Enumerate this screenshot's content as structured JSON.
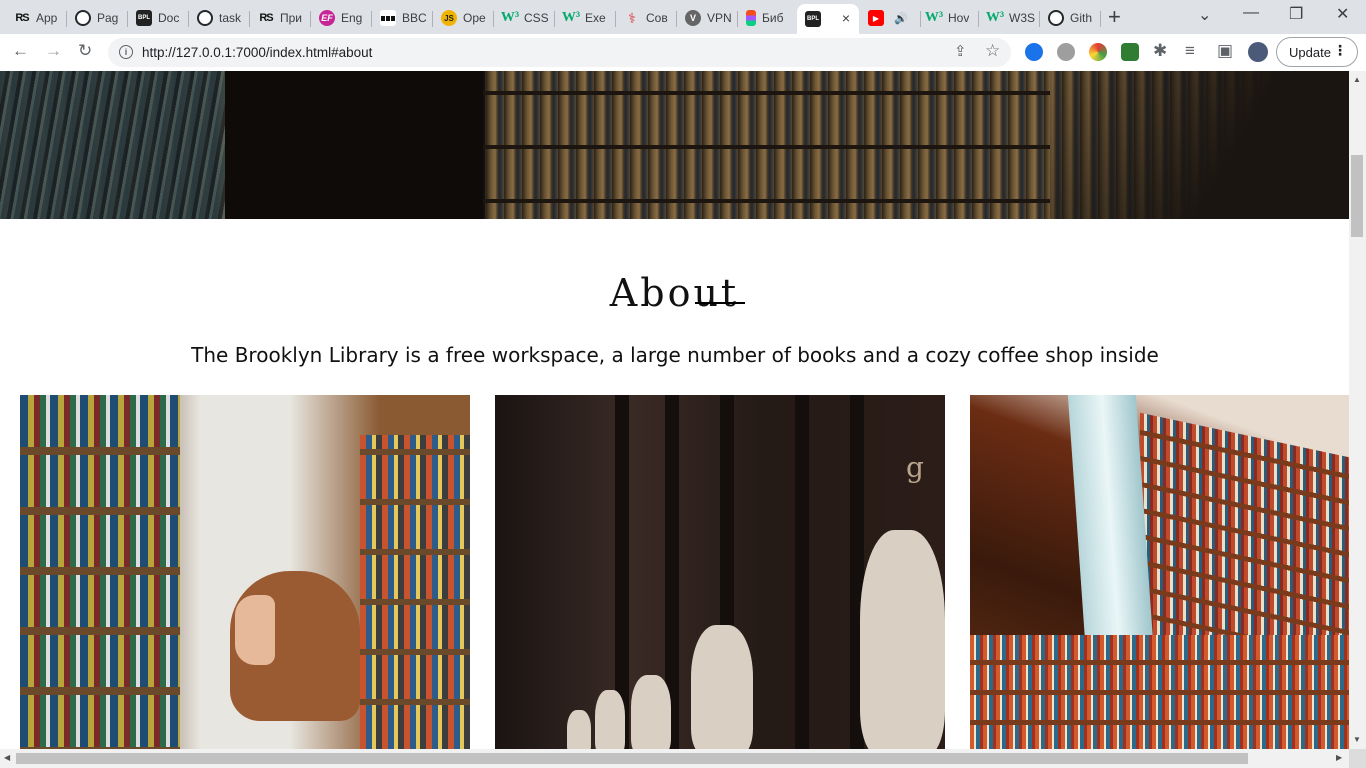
{
  "browser": {
    "tabs": [
      {
        "label": "App",
        "icon": "rs-school-icon"
      },
      {
        "label": "Pag",
        "icon": "github-icon"
      },
      {
        "label": "Doc",
        "icon": "bpl-icon"
      },
      {
        "label": "task",
        "icon": "github-icon"
      },
      {
        "label": "При",
        "icon": "rs-school-icon"
      },
      {
        "label": "Eng",
        "icon": "ef-icon"
      },
      {
        "label": "BBC",
        "icon": "bbc-icon"
      },
      {
        "label": "Ope",
        "icon": "js-icon"
      },
      {
        "label": "CSS",
        "icon": "w3schools-icon"
      },
      {
        "label": "Exe",
        "icon": "w3schools-icon"
      },
      {
        "label": "Сов",
        "icon": "figure-icon"
      },
      {
        "label": "VPN",
        "icon": "vpn-icon"
      },
      {
        "label": "Биб",
        "icon": "figma-icon"
      },
      {
        "label": "",
        "icon": "bpl-icon",
        "active": true
      },
      {
        "label": "",
        "icon": "youtube-icon",
        "audio": true
      },
      {
        "label": "Hov",
        "icon": "w3schools-icon"
      },
      {
        "label": "W3S",
        "icon": "w3schools-icon"
      },
      {
        "label": "Gith",
        "icon": "github-icon"
      }
    ],
    "url": "http://127.0.0.1:7000/index.html#about",
    "update_label": "Update",
    "glyphs": {
      "new_tab": "+",
      "close": "×",
      "minimize": "—",
      "maximize": "❐",
      "window_close": "✕",
      "tab_search": "⌄",
      "back": "←",
      "forward": "→",
      "reload": "↻",
      "info": "i",
      "share": "⇪",
      "star": "☆",
      "extensions": "✱",
      "reading_list": "≡",
      "sidebar": "▣",
      "menu": "⋮",
      "audio": "🔊",
      "scroll_up": "▲",
      "scroll_down": "▼",
      "scroll_left": "◀",
      "scroll_right": "▶"
    },
    "favicon_text": {
      "rs": "RS",
      "bpl": "BPL",
      "ef": "EF",
      "js": "JS",
      "w3": "W³",
      "cov": "⚕",
      "vpn": "V",
      "yt": "▶"
    }
  },
  "page": {
    "about": {
      "title": "About",
      "text": "The Brooklyn Library is a free workspace, a large number of books and a cozy coffee shop inside"
    },
    "photo_glyph": "g"
  },
  "colors": {
    "tabstrip": "#dee1e6",
    "toolbar": "#ffffff",
    "omnibox": "#f1f3f4"
  }
}
